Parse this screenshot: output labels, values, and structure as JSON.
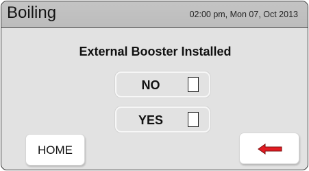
{
  "header": {
    "title": "Boiling",
    "datetime": "02:00 pm, Mon 07, Oct 2013"
  },
  "main": {
    "heading": "External Booster Installed",
    "options": [
      {
        "label": "NO",
        "checked": false
      },
      {
        "label": "YES",
        "checked": false
      }
    ]
  },
  "footer": {
    "home_label": "HOME",
    "back_icon": "left-arrow-icon"
  },
  "colors": {
    "panel_background": "#e2e2e2",
    "titlebar_background": "#c0c0c0",
    "arrow_fill": "#e21b22",
    "arrow_outline": "#7a0c0c"
  }
}
